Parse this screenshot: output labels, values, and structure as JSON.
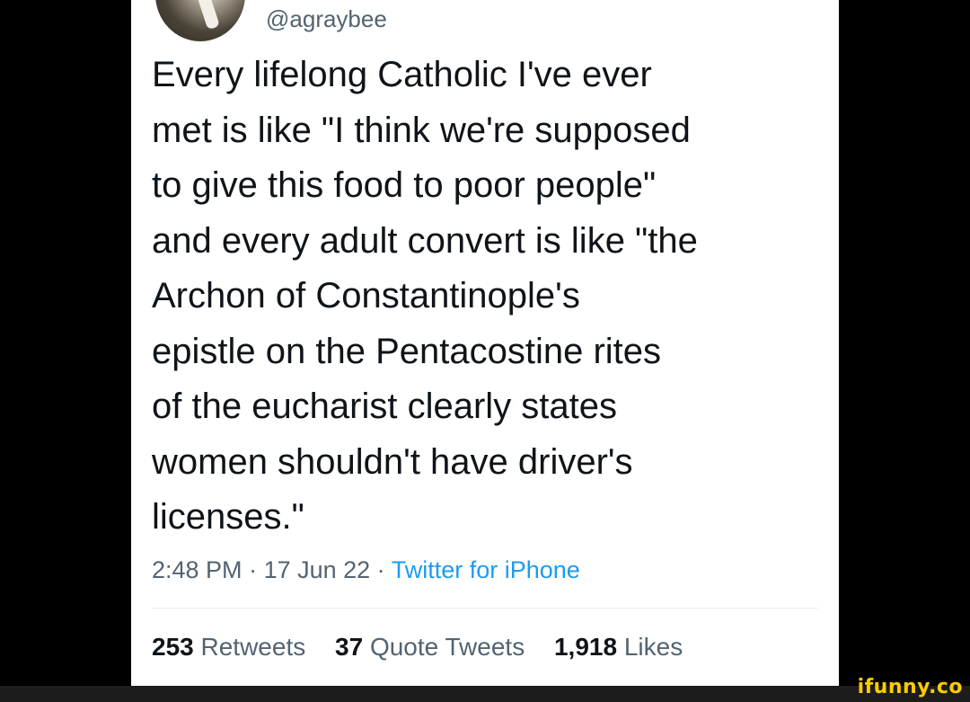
{
  "tweet": {
    "handle": "@agraybee",
    "text_lines": [
      "Every lifelong Catholic I've ever",
      "met is like \"I think we're supposed",
      "to give this food to poor people\"",
      "and every adult convert is like \"the",
      "Archon of Constantinople's",
      "epistle on the Pentacostine rites",
      "of the eucharist clearly states",
      "women shouldn't have driver's",
      "licenses.\""
    ],
    "meta": {
      "time": "2:48 PM",
      "separator": " · ",
      "date": "17 Jun 22",
      "source": "Twitter for iPhone"
    },
    "stats": {
      "retweets_count": "253",
      "retweets_label": "Retweets",
      "quotes_count": "37",
      "quotes_label": "Quote Tweets",
      "likes_count": "1,918",
      "likes_label": "Likes"
    }
  },
  "watermark": "ifunny.co",
  "colors": {
    "background": "#000000",
    "card": "#ffffff",
    "text": "#0f1419",
    "secondary": "#536471",
    "link": "#1d9bf0",
    "watermark": "#ffcc00"
  }
}
